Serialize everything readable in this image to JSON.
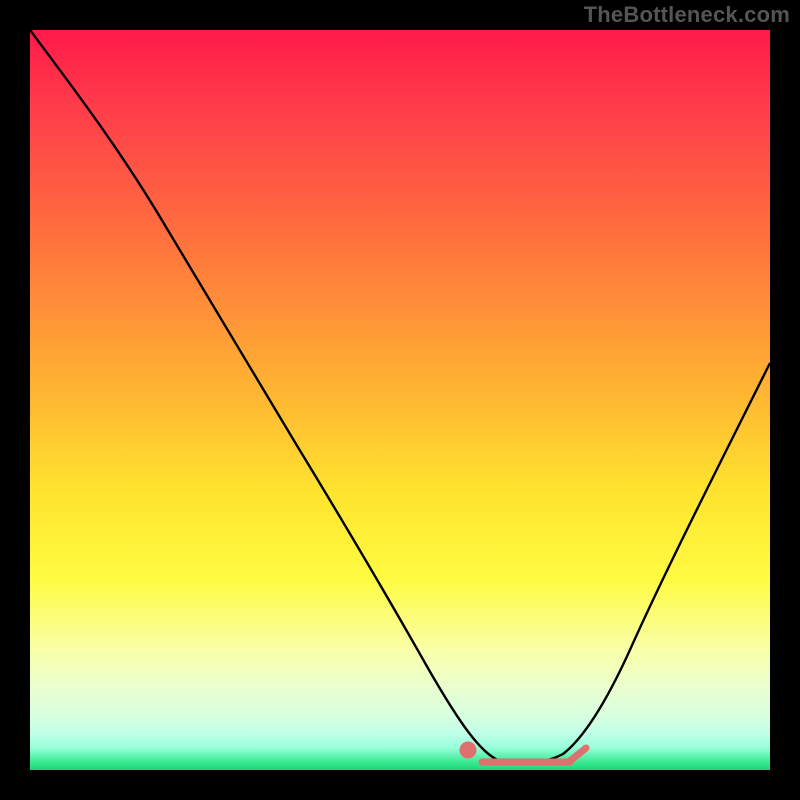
{
  "watermark": "TheBottleneck.com",
  "colors": {
    "outer_bg": "#000000",
    "watermark_color": "#555555",
    "curve_stroke": "#000000",
    "sweet_spot": "#e57373"
  },
  "chart_data": {
    "type": "line",
    "title": "",
    "xlabel": "",
    "ylabel": "",
    "axes_visible": false,
    "xlim": [
      0,
      100
    ],
    "ylim": [
      0,
      100
    ],
    "background_gradient_meaning": "bottleneck severity (red high, green low)",
    "series": [
      {
        "name": "bottleneck-curve",
        "stroke": "#000000",
        "x": [
          0,
          6,
          12,
          18,
          24,
          30,
          36,
          42,
          48,
          52,
          56,
          60,
          63,
          66,
          70,
          74,
          78,
          82,
          86,
          90,
          95,
          100
        ],
        "y": [
          100,
          92,
          83,
          74,
          64,
          55,
          45,
          35,
          25,
          18,
          11,
          5,
          2,
          1,
          1,
          2,
          7,
          15,
          24,
          33,
          44,
          55
        ]
      }
    ],
    "annotations": [
      {
        "name": "sweet-spot-band",
        "type": "marker-strip",
        "color": "#e57373",
        "x_range": [
          58,
          76
        ],
        "y": 1
      }
    ]
  }
}
